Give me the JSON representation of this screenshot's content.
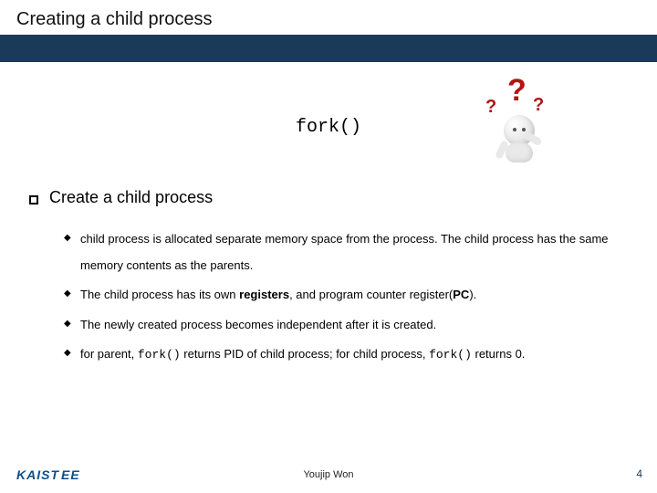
{
  "title": "Creating a child process",
  "code": "fork()",
  "heading": "Create a child process",
  "bullets": [
    [
      {
        "t": "child process is allocated separate memory space from the process. The child process has the same memory contents as the parents."
      }
    ],
    [
      {
        "t": "The child process has its own "
      },
      {
        "t": "registers",
        "b": true
      },
      {
        "t": ", and program counter register("
      },
      {
        "t": "PC",
        "b": true
      },
      {
        "t": ")."
      }
    ],
    [
      {
        "t": "The newly created process becomes independent after it is created."
      }
    ],
    [
      {
        "t": "for parent, "
      },
      {
        "t": "fork()",
        "m": true
      },
      {
        "t": " returns PID of child process; for child process, "
      },
      {
        "t": "fork()",
        "m": true
      },
      {
        "t": " returns 0."
      }
    ]
  ],
  "footer": {
    "author": "Youjip Won",
    "page": "4",
    "logo": "KAIST",
    "logo_suffix": "EE"
  },
  "qmarks": {
    "big": "?",
    "small_left": "?",
    "small_right": "?"
  }
}
